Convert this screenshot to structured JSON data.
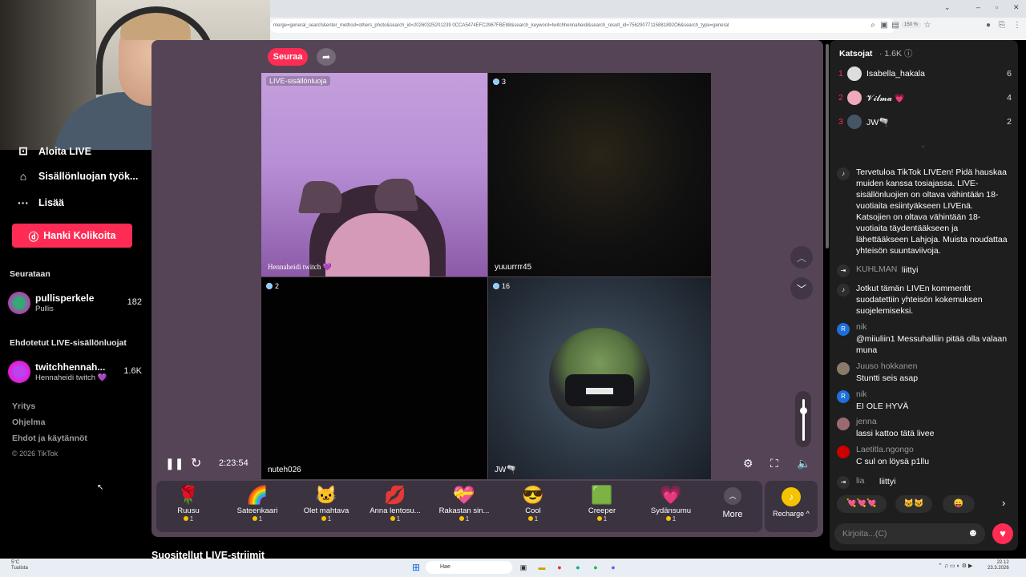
{
  "browser": {
    "url": "merge=general_search&enter_method=others_photo&search_id=20260325201239 0CCA5474EFC2967FBE88&search_keyword=twitchhennaheidi&search_result_id=75629077115881892O6&search_type=general",
    "zoom": "150 %"
  },
  "sidebar": {
    "items": [
      {
        "label": "Aloita LIVE"
      },
      {
        "label": "Sisällönluojan työk..."
      },
      {
        "label": "Lisää"
      }
    ],
    "coins_button": "Hanki Kolikoita",
    "following_title": "Seurataan",
    "following": [
      {
        "name": "pullisperkele",
        "sub": "Pullis",
        "count": "182"
      }
    ],
    "suggested_title": "Ehdotetut LIVE-sisällönluojat",
    "suggested": [
      {
        "name": "twitchhennah...",
        "sub": "Hennaheidi twitch 💜",
        "count": "1.6K"
      }
    ],
    "footer": [
      "Yritys",
      "Ohjelma",
      "Ehdot ja käytännöt",
      "© 2026 TikTok"
    ]
  },
  "stream": {
    "follow_label": "Seuraa",
    "tiles": [
      {
        "badge": "LIVE-sisällönluoja",
        "name": "Hennaheidi twitch 💜"
      },
      {
        "badge": "3",
        "name": "yuuurrrr45"
      },
      {
        "badge": "2",
        "name": "nuteh026"
      },
      {
        "badge": "16",
        "name": "JW🫗"
      }
    ],
    "timer": "2:23:54"
  },
  "gifts": {
    "items": [
      {
        "icon": "🌹",
        "label": "Ruusu",
        "price": "1"
      },
      {
        "icon": "🌈",
        "label": "Sateenkaari",
        "price": "1"
      },
      {
        "icon": "🐱",
        "label": "Olet mahtava",
        "price": "1"
      },
      {
        "icon": "💋",
        "label": "Anna lentosu...",
        "price": "1"
      },
      {
        "icon": "💝",
        "label": "Rakastan sin...",
        "price": "1"
      },
      {
        "icon": "😎",
        "label": "Cool",
        "price": "1"
      },
      {
        "icon": "🟩",
        "label": "Creeper",
        "price": "1"
      },
      {
        "icon": "💗",
        "label": "Sydänsumu",
        "price": "1"
      }
    ],
    "more_label": "More",
    "recharge_label": "Recharge ^"
  },
  "suggested_streams_title": "Suositellut LIVE-striimit",
  "chat": {
    "viewers_title": "Katsojat",
    "viewers_count": "· 1.6K",
    "top_viewers": [
      {
        "rank": "1",
        "name": "Isabella_hakala",
        "score": "6"
      },
      {
        "rank": "2",
        "name": "𝓥𝓲𝓵𝓶𝓪 💗",
        "score": "4"
      },
      {
        "rank": "3",
        "name": "JW🫗",
        "score": "2"
      }
    ],
    "messages": [
      {
        "user": "",
        "text": "Tervetuloa TikTok LIVEen! Pidä hauskaa muiden kanssa tosiajassa. LIVE-sisällönluojien on oltava vähintään 18-vuotiaita esiintyäkseen LIVEnä. Katsojien on oltava vähintään 18-vuotiaita täydentääkseen ja lähettääkseen Lahjoja. Muista noudattaa yhteisön suuntaviivoja."
      },
      {
        "user": "KUHLMAN",
        "text": "liittyi"
      },
      {
        "user": "",
        "text": "Jotkut tämän LIVEn kommentit suodatettiin yhteisön kokemuksen suojelemiseksi."
      },
      {
        "user": "nik",
        "text": "@miiuliin1 Messuhalliin pitää olla valaan muna"
      },
      {
        "user": "Juuso hokkanen",
        "text": "Stuntti seis asap"
      },
      {
        "user": "nik",
        "text": "EI OLE HYVÄ"
      },
      {
        "user": "jenna",
        "text": "lassi kattoo tätä livee"
      },
      {
        "user": "Laetitla.ngongo",
        "text": "C sul on löysä p1llu"
      },
      {
        "user": "lia",
        "text": "liittyi"
      }
    ],
    "reactions": [
      "💘💘💘",
      "🐱🐱",
      "😛"
    ],
    "input_placeholder": "Kirjoita...(C)"
  },
  "taskbar": {
    "weather_temp": "5°C",
    "weather_place": "Tuulista",
    "search": "Hae",
    "time": "22.12",
    "date": "23.3.2026"
  }
}
